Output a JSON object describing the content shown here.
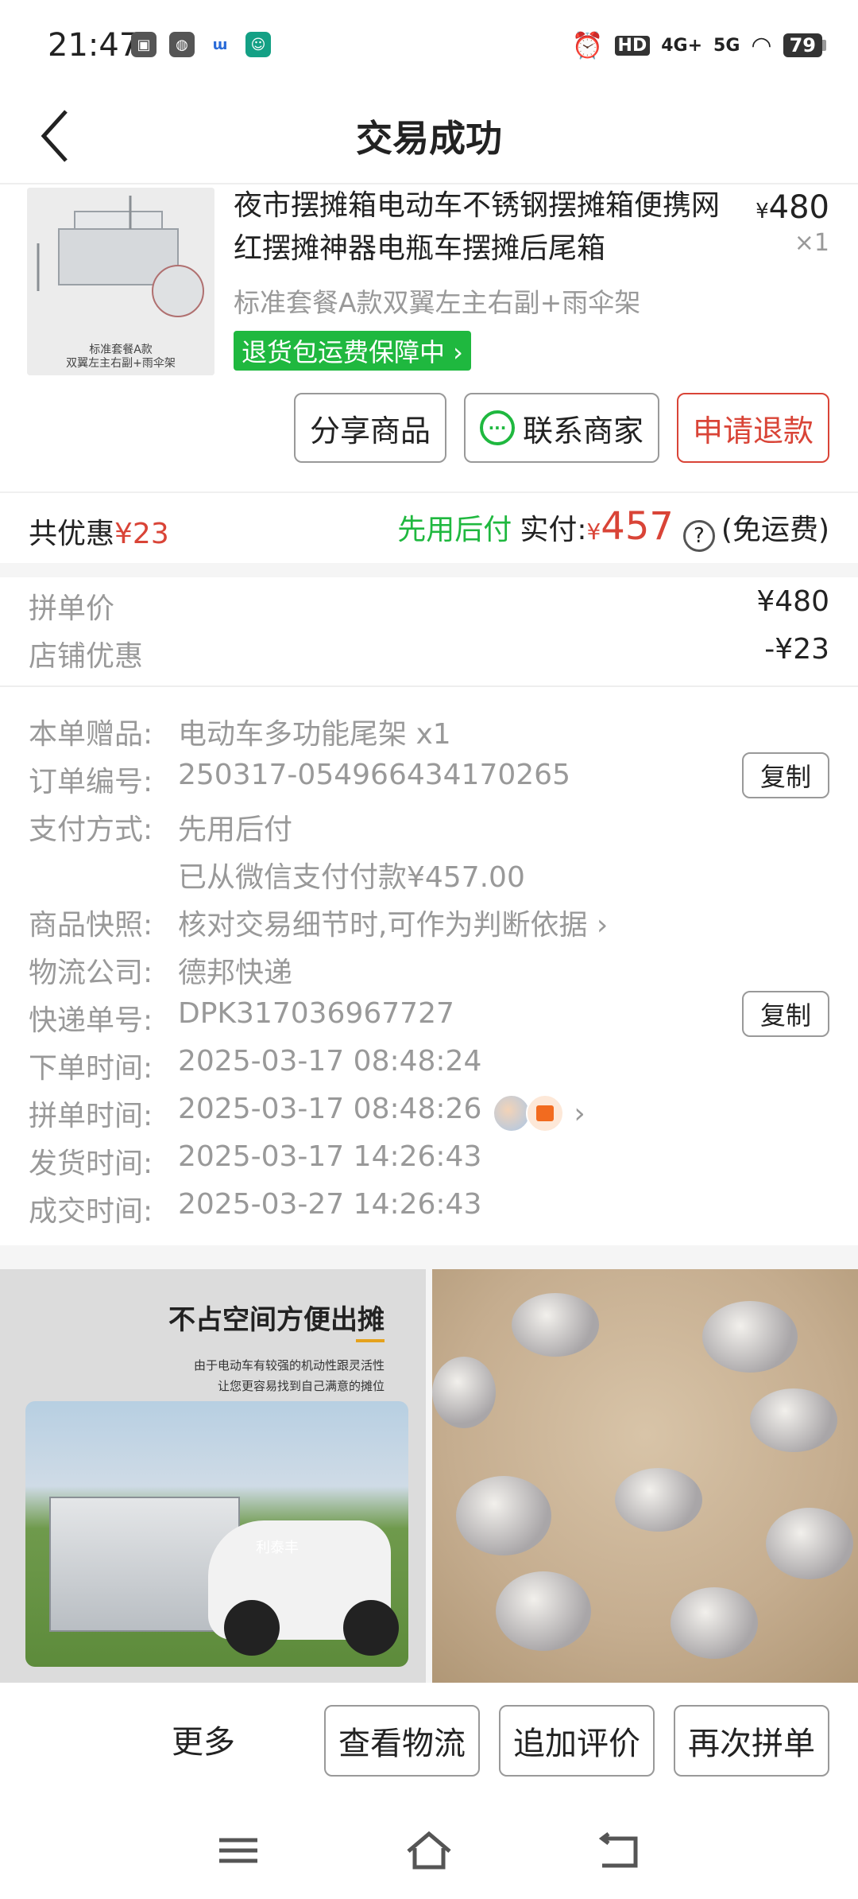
{
  "status_bar": {
    "time": "21:47",
    "network_hd": "HD",
    "network_4g": "4G+",
    "network_5g": "5G",
    "battery": "79"
  },
  "header": {
    "title": "交易成功"
  },
  "product": {
    "image_caption": "标准套餐A款\n双翼左主右副+雨伞架",
    "title": "夜市摆摊箱电动车不锈钢摆摊箱便携网红摆摊神器电瓶车摆摊后尾箱",
    "price_symbol": "¥",
    "price": "480",
    "quantity": "×1",
    "spec": "标准套餐A款双翼左主右副+雨伞架",
    "guarantee": "退货包运费保障中 ›"
  },
  "actions": {
    "share": "分享商品",
    "contact": "联系商家",
    "refund": "申请退款"
  },
  "summary": {
    "discount_label": "共优惠",
    "discount_value": "¥23",
    "pay_later": "先用后付",
    "paid_label": "实付:",
    "paid_symbol": "¥",
    "paid_value": "457",
    "question": "?",
    "shipping_note": "(免运费)"
  },
  "price_rows": [
    {
      "label": "拼单价",
      "value": "¥480"
    },
    {
      "label": "店铺优惠",
      "value": "-¥23"
    }
  ],
  "order_info": {
    "gift_label": "本单赠品:",
    "gift_value": "电动车多功能尾架 x1",
    "order_no_label": "订单编号:",
    "order_no_value": "250317-054966434170265",
    "copy": "复制",
    "pay_method_label": "支付方式:",
    "pay_method_value": "先用后付",
    "pay_detail": "已从微信支付付款¥457.00",
    "snapshot_label": "商品快照:",
    "snapshot_value": "核对交易细节时,可作为判断依据 ›",
    "logistics_label": "物流公司:",
    "logistics_value": "德邦快递",
    "tracking_label": "快递单号:",
    "tracking_value": "DPK317036967727",
    "order_time_label": "下单时间:",
    "order_time_value": "2025-03-17 08:48:24",
    "group_time_label": "拼单时间:",
    "group_time_value": "2025-03-17 08:48:26",
    "ship_time_label": "发货时间:",
    "ship_time_value": "2025-03-17 14:26:43",
    "deal_time_label": "成交时间:",
    "deal_time_value": "2025-03-27 14:26:43"
  },
  "gallery": {
    "left_heading": "不占空间方便出摊",
    "left_sub_1": "由于电动车有较强的机动性跟灵活性",
    "left_sub_2": "让您更容易找到自己满意的摊位",
    "scooter_brand": "利泰丰"
  },
  "bottom_bar": {
    "more": "更多",
    "logistics": "查看物流",
    "review": "追加评价",
    "reorder": "再次拼单"
  }
}
